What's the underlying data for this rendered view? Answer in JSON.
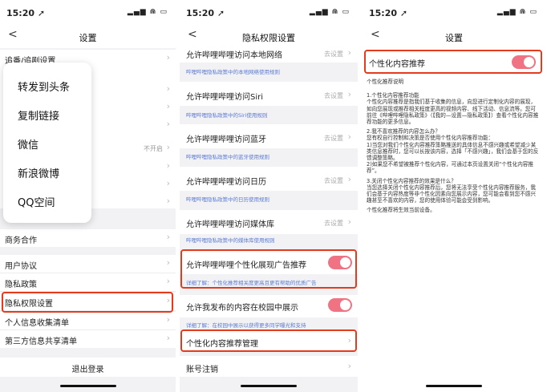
{
  "status": {
    "time": "15:20 ➚",
    "icons": "▂▄▆ ⋒ ▭"
  },
  "phone1": {
    "title": "设置",
    "back": "<",
    "rows": [
      {
        "label": "追番/追剧设置",
        "value": ""
      },
      {
        "label": "",
        "value": "不开启"
      },
      {
        "label": "商务合作",
        "value": ""
      },
      {
        "label": "用户协议",
        "value": ""
      },
      {
        "label": "隐私政策",
        "value": ""
      },
      {
        "label": "隐私权限设置",
        "value": ""
      },
      {
        "label": "个人信息收集清单",
        "value": ""
      },
      {
        "label": "第三方信息共享清单",
        "value": ""
      }
    ],
    "logout": "退出登录",
    "share_menu": [
      "转发到头条",
      "复制链接",
      "微信",
      "新浪微博",
      "QQ空间"
    ]
  },
  "phone2": {
    "title": "隐私权限设置",
    "items": [
      {
        "label": "允许哔哩哔哩访问本地网络",
        "value": "去设置",
        "link": "哔哩哔哩隐私政策中的本地网络使用规则"
      },
      {
        "label": "允许哔哩哔哩访问Siri",
        "value": "去设置",
        "link": "哔哩哔哩隐私政策中的Siri使用规则"
      },
      {
        "label": "允许哔哩哔哩访问蓝牙",
        "value": "去设置",
        "link": "哔哩哔哩隐私政策中的蓝牙使用规则"
      },
      {
        "label": "允许哔哩哔哩访问日历",
        "value": "去设置",
        "link": "哔哩哔哩隐私政策中的日历使用规则"
      },
      {
        "label": "允许哔哩哔哩访问媒体库",
        "value": "去设置",
        "link": "哔哩哔哩隐私政策中的媒体库使用规则"
      }
    ],
    "ad_toggle": {
      "label": "允许哔哩哔哩个性化展现广告推荐",
      "link": "详细了解：个性化推荐相关度更高且更有帮助的优质广告",
      "on": true
    },
    "campus_toggle": {
      "label": "允许我发布的内容在校园中展示",
      "link": "详细了解：在校园中展示以获得更多同学曝光和支持",
      "on": true
    },
    "personal_rec": "个性化内容推荐管理",
    "account": "账号注销"
  },
  "phone3": {
    "title": "设置",
    "toggle_label": "个性化内容推荐",
    "toggle_on": true,
    "desc_title": "个性化推荐说明",
    "paragraphs": [
      "1.个性化内容推荐功能\n个性化内容推荐是指我们基于收集的信息，向您进行定制化内容的展现，如向您展现或推荐相关程度更高的视频内容、线下活动、信息流等。您可前往《哔哩哔哩隐私政策》（【我的—设置—隐私政策】）查看个性化内容推荐功能的更多信息。",
      "2.我不喜欢推荐的内容怎么办？\n您有权自行控制和决策是否使用个性化内容推荐功能：\n1)当您对我们个性化内容推荐策略推送的具体信息不感兴趣或希望减少某类信息推荐时，您可以长按该内容，选择「不感兴趣」，我们会基于您的反馈调整策略。\n2)如果您不希望被推荐个性化内容，可通过本页设置关闭“个性化内容推荐”。",
      "3.关闭个性化内容推荐的效果是什么？\n当您选择关闭个性化内容推荐后，您将无法享受个性化内容推荐服务，我们会基于内容热度等非个性化因素向您展示内容，您可能会看到您不感兴趣甚至不喜欢的内容，您的使用体验可能会受到影响。",
      "个性化推荐将生效当前设备。"
    ]
  },
  "colors": {
    "accent": "#f07383",
    "highlight": "#e23b1e",
    "link": "#5b7bd6"
  }
}
